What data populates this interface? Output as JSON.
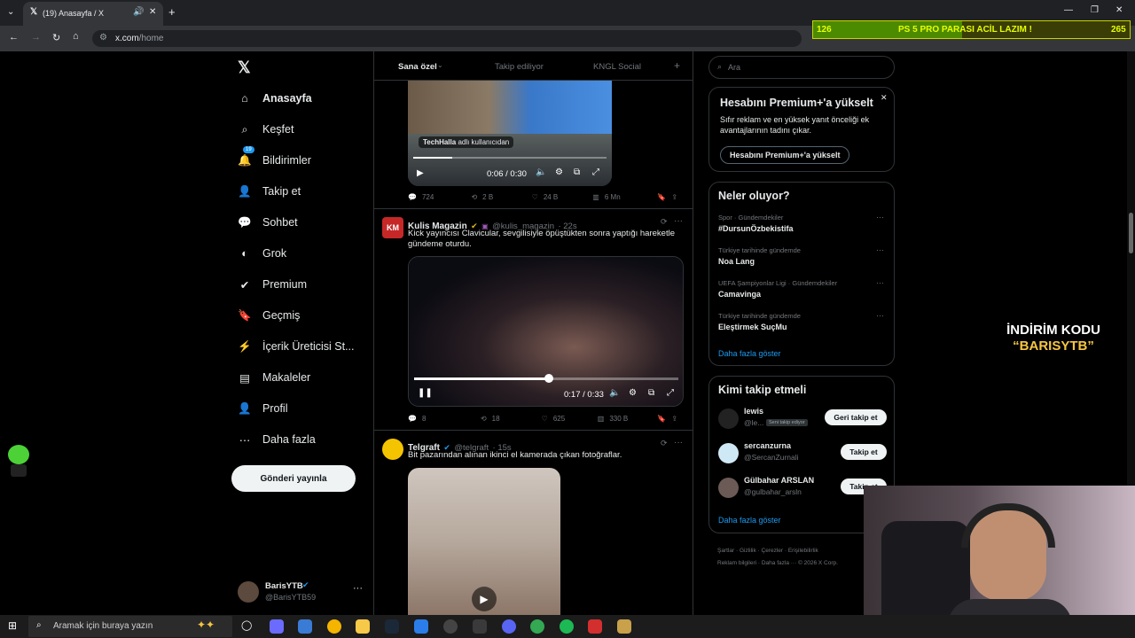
{
  "browser": {
    "tab_title": "(19) Anasayfa / X",
    "url_host": "x.com",
    "url_path": "/home"
  },
  "overlay": {
    "left_count": "126",
    "message": "PS 5 PRO PARASI ACİL LAZIM !",
    "right_count": "265",
    "progress_fraction": 0.47
  },
  "sidebar": {
    "items": [
      {
        "label": "Anasayfa",
        "icon": "home-icon"
      },
      {
        "label": "Keşfet",
        "icon": "search-icon"
      },
      {
        "label": "Bildirimler",
        "icon": "bell-icon",
        "badge": "19"
      },
      {
        "label": "Takip et",
        "icon": "add-user-icon"
      },
      {
        "label": "Sohbet",
        "icon": "chat-icon"
      },
      {
        "label": "Grok",
        "icon": "grok-icon"
      },
      {
        "label": "Premium",
        "icon": "verified-icon"
      },
      {
        "label": "Geçmiş",
        "icon": "bookmark-icon"
      },
      {
        "label": "İçerik Üreticisi St...",
        "icon": "bolt-icon"
      },
      {
        "label": "Makaleler",
        "icon": "article-icon"
      },
      {
        "label": "Profil",
        "icon": "person-icon"
      },
      {
        "label": "Daha fazla",
        "icon": "more-circle-icon"
      }
    ],
    "post_button": "Gönderi yayınla",
    "account": {
      "name": "BarisYTB",
      "handle": "@BarisYTB59"
    }
  },
  "feed": {
    "tabs": [
      "Sana özel",
      "Takip ediliyor",
      "KNGL Social"
    ],
    "tweets": [
      {
        "media_caption_user": "TechHalla",
        "media_caption_suffix": "adlı kullanıcıdan",
        "video_time": "0:06 / 0:30",
        "video_progress": 0.2,
        "stats": {
          "replies": "724",
          "reposts": "2 B",
          "likes": "24 B",
          "views": "6 Mn"
        }
      },
      {
        "name": "Kulis Magazin",
        "handle": "@kulis_magazin",
        "time": "· 22s",
        "avatar_text": "KM",
        "text": "Kick yayıncısı Clavicular, sevgilisiyle öpüştükten sonra yaptığı hareketle gündeme oturdu.",
        "video_time": "0:17 / 0:33",
        "video_progress": 0.51,
        "stats": {
          "replies": "8",
          "reposts": "18",
          "likes": "625",
          "views": "330 B"
        }
      },
      {
        "name": "Telgraft",
        "handle": "@telgraft",
        "time": "· 15s",
        "text": "Bit pazarından alınan ikinci el kamerada çıkan fotoğraflar."
      }
    ]
  },
  "right": {
    "search_placeholder": "Ara",
    "premium": {
      "title": "Hesabını Premium+'a yükselt",
      "text": "Sıfır reklam ve en yüksek yanıt önceliği ek avantajlarının tadını çıkar.",
      "button": "Hesabını Premium+'a yükselt"
    },
    "trends": {
      "title": "Neler oluyor?",
      "items": [
        {
          "context": "Spor · Gündemdekiler",
          "name": "#DursunÖzbekistifa"
        },
        {
          "context": "Türkiye tarihinde gündemde",
          "name": "Noa Lang"
        },
        {
          "context": "UEFA Şampiyonlar Ligi · Gündemdekiler",
          "name": "Camavinga"
        },
        {
          "context": "Türkiye tarihinde gündemde",
          "name": "Eleştirmek SuçMu"
        }
      ],
      "show_more": "Daha fazla göster"
    },
    "who_to_follow": {
      "title": "Kimi takip etmeli",
      "items": [
        {
          "name": "lewis",
          "handle": "@le...",
          "badge": "Seni takip ediyor",
          "button": "Geri takip et"
        },
        {
          "name": "sercanzurna",
          "handle": "@SercanZurnali",
          "button": "Takip et"
        },
        {
          "name": "Gülbahar ARSLAN",
          "handle": "@gulbahar_arsln",
          "button": "Takip et"
        }
      ],
      "show_more": "Daha fazla göster"
    },
    "footer": {
      "links": [
        "Şartlar",
        "Gizlilik",
        "Çerezler",
        "Erişilebilirlik",
        "Reklam bilgileri",
        "Daha fazla ···"
      ],
      "copyright": "© 2026 X Corp."
    }
  },
  "promo": {
    "line1": "İNDİRİM KODU",
    "line2": "“BARISYTB”"
  },
  "taskbar": {
    "search_placeholder": "Aramak için buraya yazın"
  },
  "colors": {
    "accent": "#1d9bf0",
    "overlay_text": "#e6ff00",
    "promo_code": "#f5c542",
    "verified_gold": "#e2b719"
  }
}
